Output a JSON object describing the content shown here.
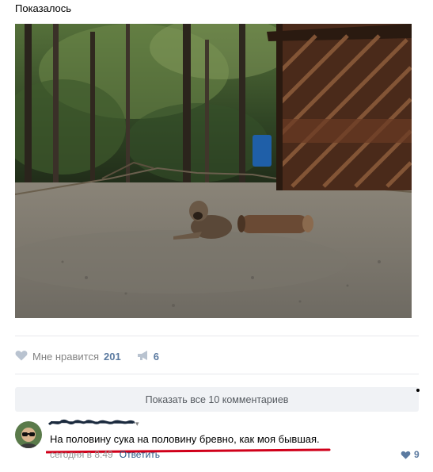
{
  "post": {
    "text": "Показалось"
  },
  "actions": {
    "like_label": "Мне нравится",
    "like_count": "201",
    "share_count": "6"
  },
  "comments": {
    "show_all_label": "Показать все 10 комментариев",
    "items": [
      {
        "text": "На половину сука на половину бревно, как моя бывшая.",
        "time": "сегодня в 8:49",
        "reply_label": "Ответить",
        "likes": "9"
      }
    ]
  },
  "colors": {
    "link": "#2a5885",
    "accent": "#5b7aa0",
    "muted": "#828282",
    "highlight_underline": "#d0001a",
    "button_bg": "#f0f2f5"
  },
  "icons": {
    "like": "heart-icon",
    "share": "megaphone-icon",
    "comment_like": "heart-icon"
  }
}
